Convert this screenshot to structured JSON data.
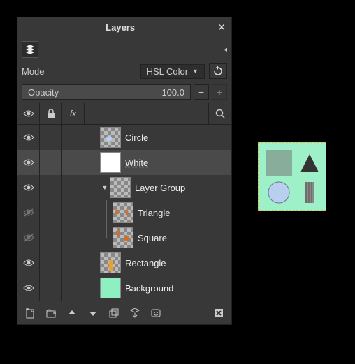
{
  "title": "Layers",
  "mode": {
    "label": "Mode",
    "value": "HSL Color"
  },
  "opacity": {
    "label": "Opacity",
    "value": "100.0"
  },
  "header": {
    "visibility": "eye",
    "lock": "lock",
    "fx": "fx",
    "search": "search"
  },
  "layers": [
    {
      "name": "Circle",
      "visible": true,
      "indent": 3,
      "thumb": "circle",
      "selected": false,
      "link": false
    },
    {
      "name": "White",
      "visible": true,
      "indent": 3,
      "thumb": "white",
      "selected": true,
      "link": true
    },
    {
      "name": "Layer Group",
      "visible": true,
      "indent": 3,
      "thumb": "checker",
      "selected": false,
      "expander": true
    },
    {
      "name": "Triangle",
      "visible": false,
      "indent": 4,
      "thumb": "triangle",
      "selected": false,
      "tree": "mid"
    },
    {
      "name": "Square",
      "visible": false,
      "indent": 4,
      "thumb": "square",
      "selected": false,
      "tree": "last"
    },
    {
      "name": "Rectangle",
      "visible": true,
      "indent": 3,
      "thumb": "rect",
      "selected": false
    },
    {
      "name": "Background",
      "visible": true,
      "indent": 3,
      "thumb": "bg",
      "selected": false
    }
  ],
  "bottom": [
    "new",
    "group",
    "up",
    "down",
    "dup",
    "merge",
    "mask",
    "delete"
  ]
}
